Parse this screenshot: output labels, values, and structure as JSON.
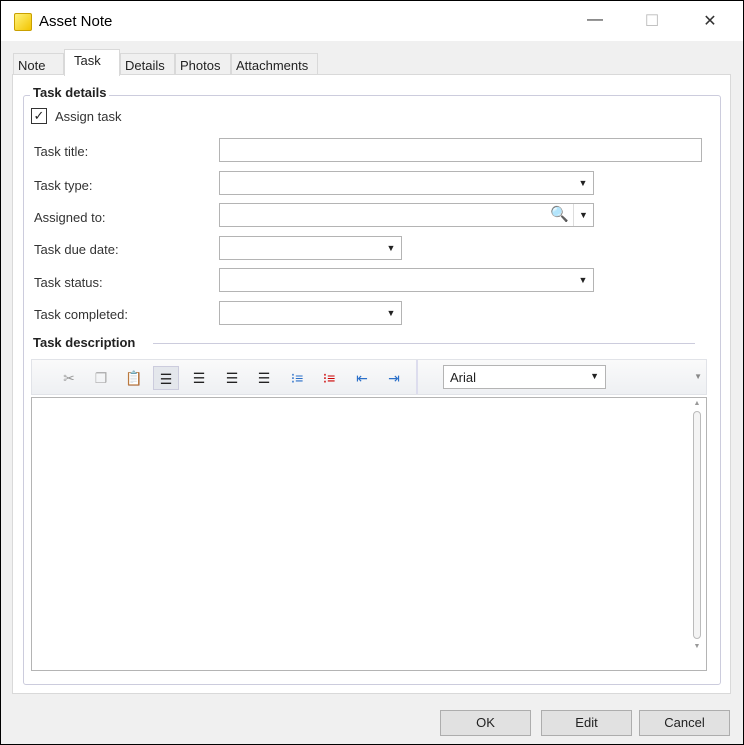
{
  "window": {
    "title": "Asset Note",
    "minimize": "—",
    "maximize": "☐",
    "close": "✕"
  },
  "tabs": [
    "Note",
    "Task",
    "Details",
    "Photos",
    "Attachments"
  ],
  "task_details": {
    "heading": "Task details",
    "assign_task_label": "Assign task",
    "assign_task_checked": true,
    "fields": {
      "title": "Task title:",
      "type": "Task type:",
      "assigned_to": "Assigned to:",
      "due_date": "Task due date:",
      "status": "Task status:",
      "completed": "Task completed:"
    }
  },
  "description": {
    "heading": "Task description",
    "font": "Arial",
    "text": ""
  },
  "buttons": {
    "ok": "OK",
    "edit": "Edit",
    "cancel": "Cancel"
  }
}
